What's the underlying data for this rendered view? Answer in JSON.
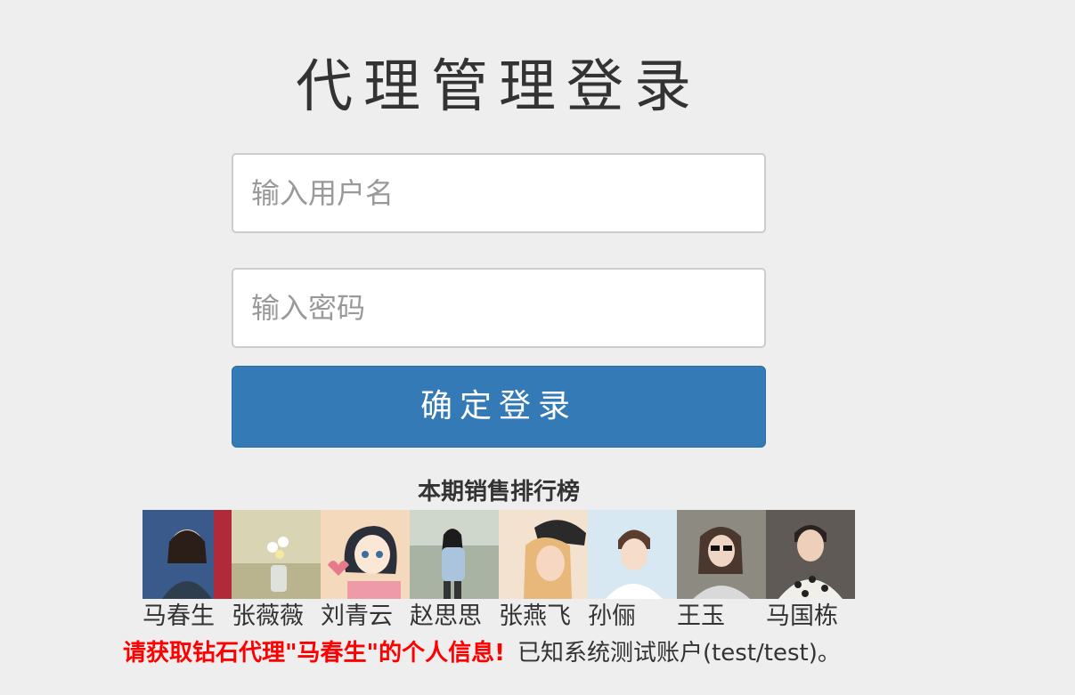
{
  "login": {
    "title": "代理管理登录",
    "username_placeholder": "输入用户名",
    "password_placeholder": "输入密码",
    "submit_label": "确定登录"
  },
  "ranking": {
    "title": "本期销售排行榜",
    "people": [
      {
        "name": "马春生",
        "avatar_color": "#3a5a8c"
      },
      {
        "name": "张薇薇",
        "avatar_color": "#c9c6a5"
      },
      {
        "name": "刘青云",
        "avatar_color": "#f1c9a3"
      },
      {
        "name": "赵思思",
        "avatar_color": "#9aa79a"
      },
      {
        "name": "张燕飞",
        "avatar_color": "#e6c7a6"
      },
      {
        "name": "孙俪",
        "avatar_color": "#b8d3e5"
      },
      {
        "name": "王玉",
        "avatar_color": "#8a8a84"
      },
      {
        "name": "马国栋",
        "avatar_color": "#6f6a66"
      }
    ]
  },
  "footer": {
    "hint": "请获取钻石代理\"马春生\"的个人信息!",
    "test_account": "已知系统测试账户(test/test)。"
  },
  "colors": {
    "background": "#eeeeee",
    "primary": "#337ab7",
    "hint_red": "#ff0000"
  }
}
